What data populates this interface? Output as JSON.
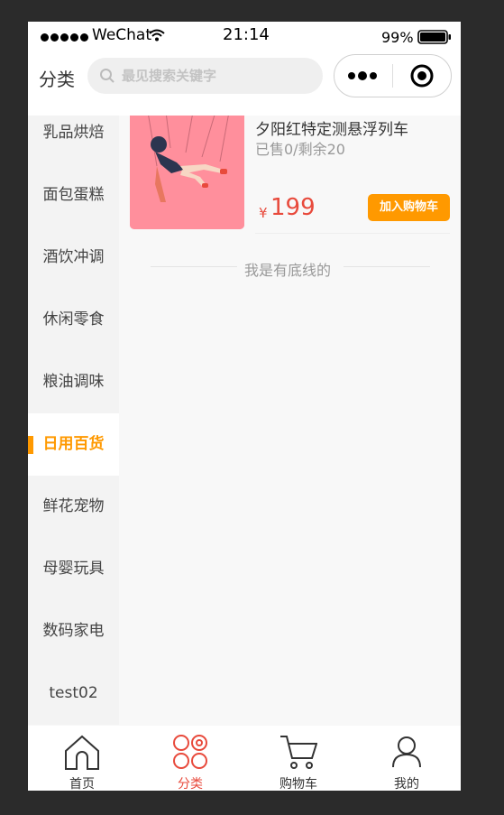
{
  "status_bar": {
    "carrier": "WeChat",
    "time": "21:14",
    "battery": "99%"
  },
  "header": {
    "title": "分类",
    "search_placeholder": "最见搜索关键字"
  },
  "sidebar": {
    "items": [
      {
        "label": "乳品烘焙",
        "active": false
      },
      {
        "label": "面包蛋糕",
        "active": false
      },
      {
        "label": "酒饮冲调",
        "active": false
      },
      {
        "label": "休闲零食",
        "active": false
      },
      {
        "label": "粮油调味",
        "active": false
      },
      {
        "label": "日用百货",
        "active": true
      },
      {
        "label": "鲜花宠物",
        "active": false
      },
      {
        "label": "母婴玩具",
        "active": false
      },
      {
        "label": "数码家电",
        "active": false
      },
      {
        "label": "test02",
        "active": false
      }
    ]
  },
  "products": [
    {
      "name": "夕阳红特定测悬浮列车",
      "sales": "已售0/剩余20",
      "currency": "¥",
      "price": "199",
      "cart_label": "加入购物车"
    }
  ],
  "end_text": "我是有底线的",
  "tabbar": {
    "items": [
      {
        "label": "首页",
        "icon": "home-icon",
        "active": false
      },
      {
        "label": "分类",
        "icon": "category-icon",
        "active": true
      },
      {
        "label": "购物车",
        "icon": "cart-icon",
        "active": false
      },
      {
        "label": "我的",
        "icon": "user-icon",
        "active": false
      }
    ]
  },
  "colors": {
    "accent": "#ff9900",
    "price": "#e84a3c",
    "active_tab": "#e84a3c"
  }
}
